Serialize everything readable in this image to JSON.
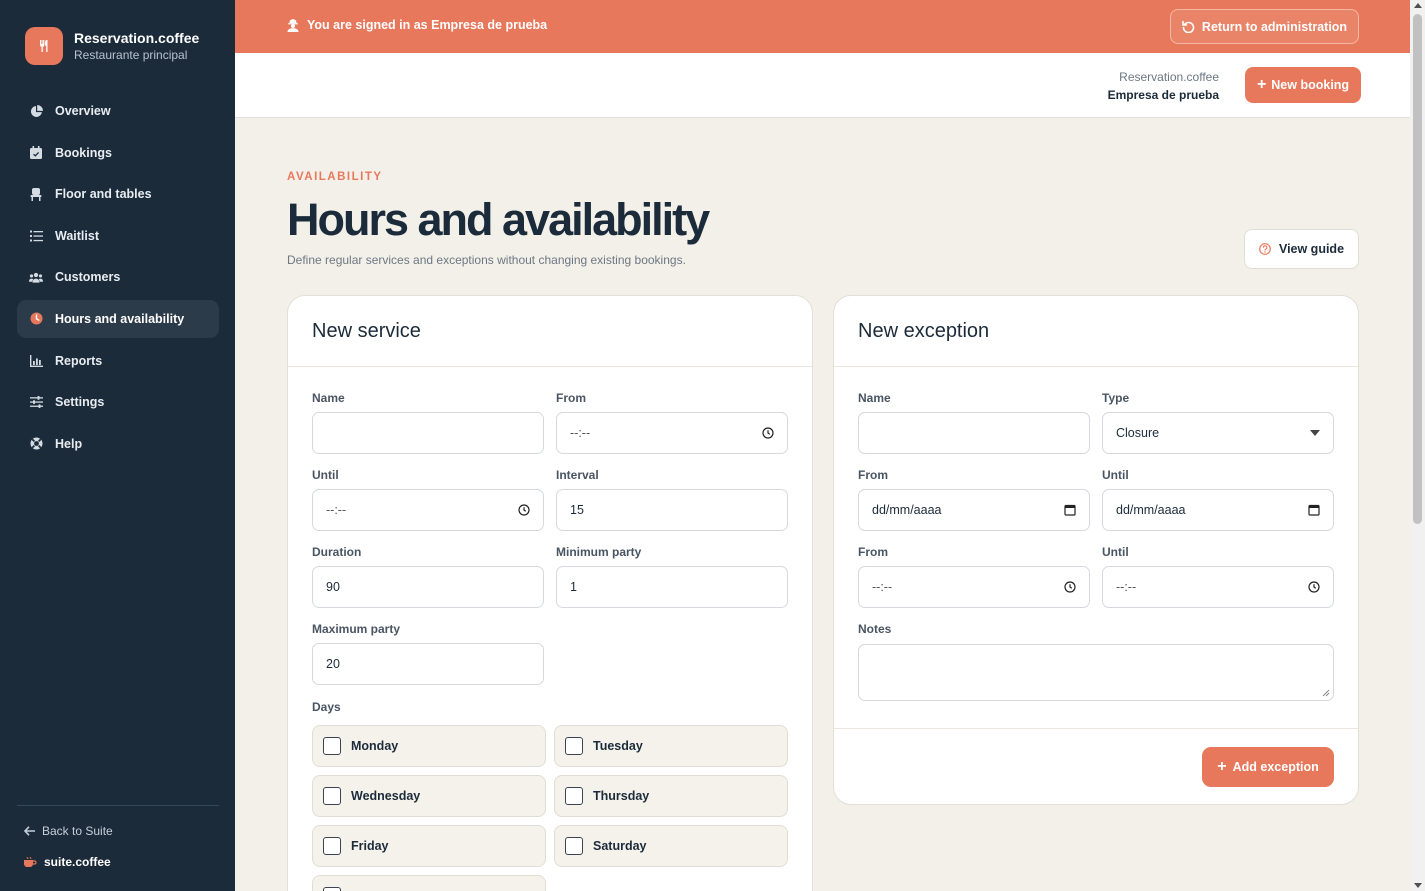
{
  "brand": {
    "name": "Reservation.coffee",
    "subtitle": "Restaurante principal"
  },
  "sidebar": {
    "items": [
      {
        "label": "Overview",
        "icon": "pie-chart-icon"
      },
      {
        "label": "Bookings",
        "icon": "calendar-icon"
      },
      {
        "label": "Floor and tables",
        "icon": "chair-icon"
      },
      {
        "label": "Waitlist",
        "icon": "list-icon"
      },
      {
        "label": "Customers",
        "icon": "users-icon"
      },
      {
        "label": "Hours and availability",
        "icon": "clock-icon",
        "active": true
      },
      {
        "label": "Reports",
        "icon": "bar-chart-icon"
      },
      {
        "label": "Settings",
        "icon": "sliders-icon"
      },
      {
        "label": "Help",
        "icon": "help-icon"
      }
    ],
    "back_label": "Back to Suite",
    "suite_label": "suite.coffee"
  },
  "banner": {
    "text": "You are signed in as Empresa de prueba",
    "return_label": "Return to administration"
  },
  "header": {
    "org_line1": "Reservation.coffee",
    "org_line2": "Empresa de prueba",
    "new_booking_label": "New booking"
  },
  "page": {
    "eyebrow": "AVAILABILITY",
    "title": "Hours and availability",
    "description": "Define regular services and exceptions without changing existing bookings.",
    "guide_label": "View guide"
  },
  "service": {
    "title": "New service",
    "name_label": "Name",
    "name_value": "",
    "from_label": "From",
    "from_value": "--:--",
    "until_label": "Until",
    "until_value": "--:--",
    "interval_label": "Interval",
    "interval_value": "15",
    "duration_label": "Duration",
    "duration_value": "90",
    "min_party_label": "Minimum party",
    "min_party_value": "1",
    "max_party_label": "Maximum party",
    "max_party_value": "20",
    "days_label": "Days",
    "days": [
      "Monday",
      "Tuesday",
      "Wednesday",
      "Thursday",
      "Friday",
      "Saturday"
    ]
  },
  "exception": {
    "title": "New exception",
    "name_label": "Name",
    "name_value": "",
    "type_label": "Type",
    "type_value": "Closure",
    "from_date_label": "From",
    "from_date_value": "dd/mm/aaaa",
    "until_date_label": "Until",
    "until_date_value": "dd/mm/aaaa",
    "from_time_label": "From",
    "from_time_value": "--:--",
    "until_time_label": "Until",
    "until_time_value": "--:--",
    "notes_label": "Notes",
    "add_label": "Add exception"
  },
  "colors": {
    "accent": "#e8785c",
    "sidebar": "#1b2b3a",
    "background": "#f3f0ea"
  }
}
